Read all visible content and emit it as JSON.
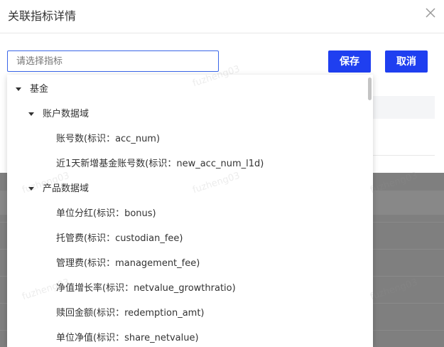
{
  "modal": {
    "title": "关联指标详情",
    "close_glyph": "╳",
    "select_placeholder": "请选择指标",
    "save_label": "保存",
    "cancel_label": "取消"
  },
  "tree": {
    "root": "基金",
    "groups": [
      {
        "label": "账户数据域",
        "items": [
          "账号数(标识：acc_num)",
          "近1天新增基金账号数(标识：new_acc_num_l1d)"
        ]
      },
      {
        "label": "产品数据域",
        "items": [
          "单位分红(标识：bonus)",
          "托管费(标识：custodian_fee)",
          "管理费(标识：management_fee)",
          "净值增长率(标识：netvalue_growthratio)",
          "赎回金额(标识：redemption_amt)",
          "单位净值(标识：share_netvalue)"
        ]
      }
    ]
  },
  "watermark_text": "fuzheng03"
}
